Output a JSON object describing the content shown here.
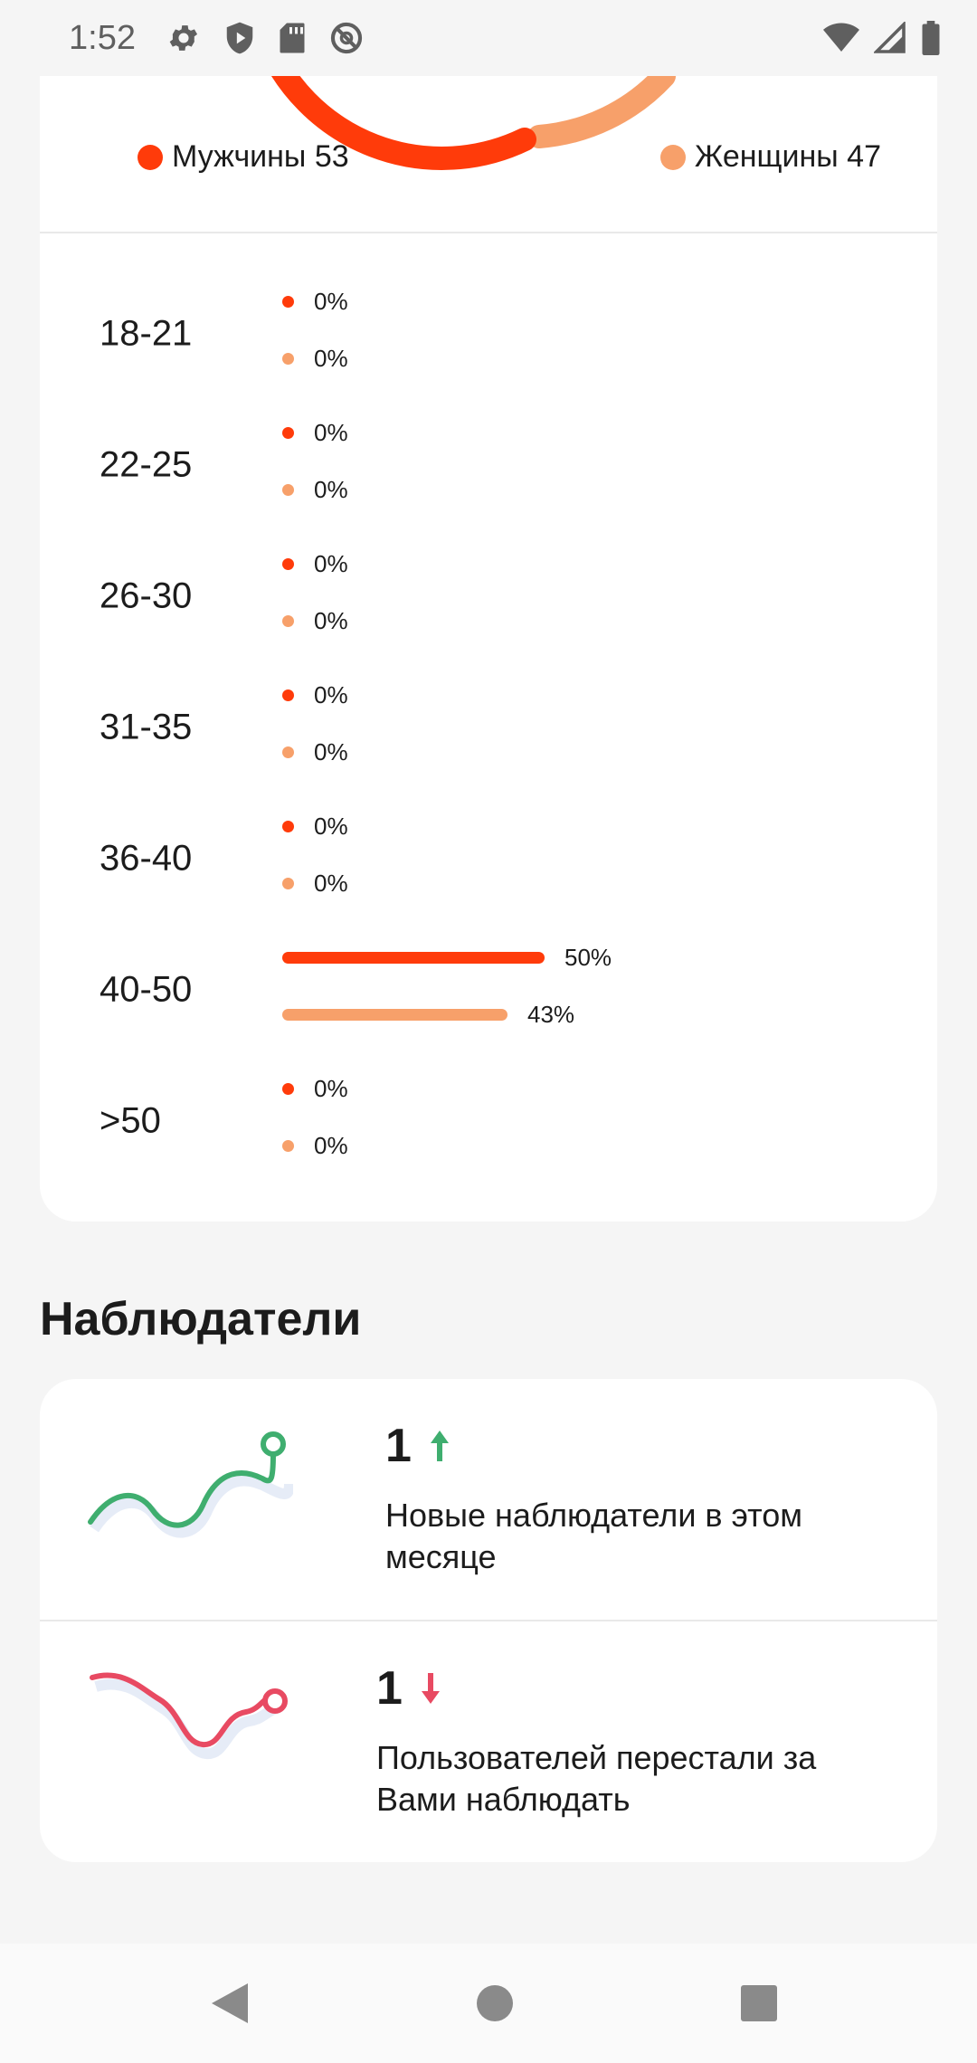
{
  "status_bar": {
    "time": "1:52",
    "icons_left": [
      "settings-icon",
      "shield-icon",
      "sd-card-icon",
      "do-not-disturb-icon"
    ],
    "icons_right": [
      "wifi-icon",
      "signal-icon",
      "battery-icon"
    ]
  },
  "gender": {
    "men_label": "Мужчины 53",
    "women_label": "Женщины 47",
    "men_color": "#ff3b0a",
    "women_color": "#f7a06a"
  },
  "age_groups": [
    {
      "label": "18-21",
      "men_pct": "0%",
      "women_pct": "0%",
      "men_value": 0,
      "women_value": 0
    },
    {
      "label": "22-25",
      "men_pct": "0%",
      "women_pct": "0%",
      "men_value": 0,
      "women_value": 0
    },
    {
      "label": "26-30",
      "men_pct": "0%",
      "women_pct": "0%",
      "men_value": 0,
      "women_value": 0
    },
    {
      "label": "31-35",
      "men_pct": "0%",
      "women_pct": "0%",
      "men_value": 0,
      "women_value": 0
    },
    {
      "label": "36-40",
      "men_pct": "0%",
      "women_pct": "0%",
      "men_value": 0,
      "women_value": 0
    },
    {
      "label": "40-50",
      "men_pct": "50%",
      "women_pct": "43%",
      "men_value": 50,
      "women_value": 43
    },
    {
      "label": ">50",
      "men_pct": "0%",
      "women_pct": "0%",
      "men_value": 0,
      "women_value": 0
    }
  ],
  "watchers": {
    "title": "Наблюдатели",
    "new": {
      "count": "1",
      "text_line1": "Новые наблюдатели в этом",
      "text_line2": "месяце",
      "color": "#3fae6f",
      "icon": "arrow-up-icon"
    },
    "lost": {
      "count": "1",
      "text_line1": "Пользователей перестали за",
      "text_line2": "Вами наблюдать",
      "color": "#e84a62",
      "icon": "arrow-down-icon"
    }
  },
  "nav": {
    "back_icon": "back-triangle-icon",
    "home_icon": "home-circle-icon",
    "recents_icon": "recents-square-icon"
  }
}
